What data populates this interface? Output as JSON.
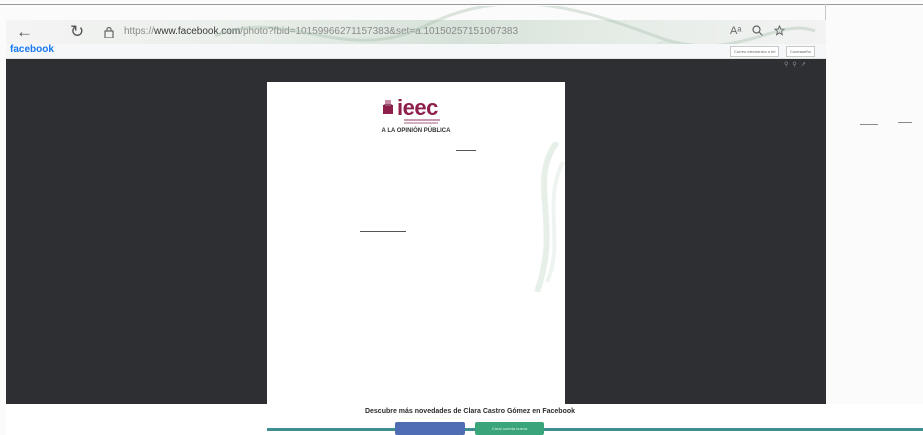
{
  "browser": {
    "url_prefix": "https://",
    "url_domain": "www.facebook.com",
    "url_path": "/photo?fbid=10159966271157383&set=a.10150257151067383",
    "back_icon": "arrow-left-icon",
    "refresh_icon": "refresh-icon",
    "lock_icon": "lock-icon",
    "read_aloud_label": "Aᵃ",
    "zoom_icon": "zoom-icon",
    "favorites_icon": "favorites-icon"
  },
  "facebook": {
    "logo": "facebook",
    "login_button": "Correo electrónico o tel",
    "password_button": "Contraseña"
  },
  "viewer": {
    "tools_icons": [
      "zoom-in-icon",
      "zoom-out-icon",
      "fullscreen-icon"
    ]
  },
  "document": {
    "logo_text": "ieec",
    "heading": "A LA OPINIÓN PÚBLICA"
  },
  "footer": {
    "cta_text": "Descubre más novedades de Clara Castro Gómez en Facebook",
    "login_label": "",
    "create_label": "Crear cuenta nueva"
  },
  "colors": {
    "viewer_bg": "#2d2f33",
    "brand_blue": "#1877f2",
    "ieec_maroon": "#8e1f4c",
    "teal_rule": "#3f8e92",
    "create_green": "#3aa57a",
    "login_blue": "#4f6db3"
  }
}
